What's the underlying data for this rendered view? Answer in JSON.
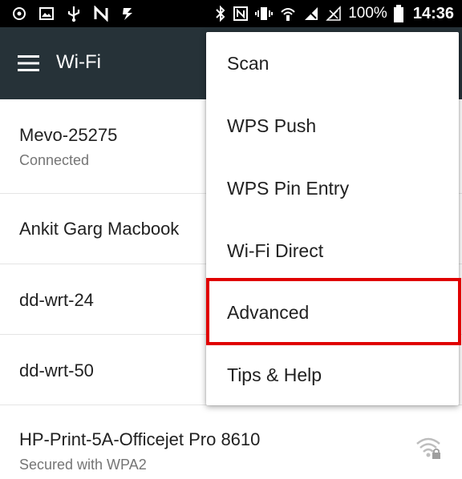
{
  "status_bar": {
    "battery": "100%",
    "time": "14:36",
    "left_icons": [
      "settings-icon",
      "image-icon",
      "usb-icon",
      "n-icon",
      "flash-icon"
    ],
    "right_icons": [
      "bluetooth-icon",
      "nfc-icon",
      "vibrate-icon",
      "hotspot-icon",
      "signal-icon",
      "no-signal-icon",
      "battery-icon"
    ]
  },
  "app_bar": {
    "title": "Wi-Fi"
  },
  "networks": [
    {
      "name": "Mevo-25275",
      "status": "Connected"
    },
    {
      "name": "Ankit Garg Macbook",
      "status": ""
    },
    {
      "name": "dd-wrt-24",
      "status": ""
    },
    {
      "name": "dd-wrt-50",
      "status": ""
    },
    {
      "name": "HP-Print-5A-Officejet Pro 8610",
      "status": "Secured with WPA2",
      "icon": "wifi-lock-icon"
    }
  ],
  "menu": {
    "items": [
      "Scan",
      "WPS Push",
      "WPS Pin Entry",
      "Wi-Fi Direct",
      "Advanced",
      "Tips & Help"
    ],
    "highlighted": "Advanced"
  },
  "colors": {
    "app_bar": "#263238",
    "status_bar": "#000000",
    "highlight": "#e00000"
  }
}
